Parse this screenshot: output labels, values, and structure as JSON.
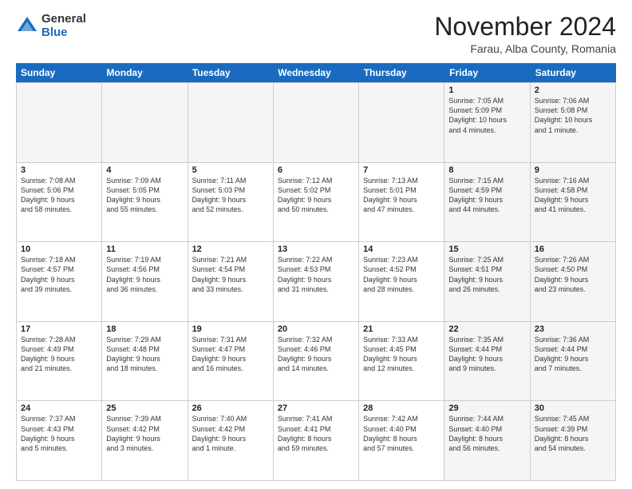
{
  "logo": {
    "general": "General",
    "blue": "Blue"
  },
  "title": {
    "month": "November 2024",
    "location": "Farau, Alba County, Romania"
  },
  "calendar": {
    "headers": [
      "Sunday",
      "Monday",
      "Tuesday",
      "Wednesday",
      "Thursday",
      "Friday",
      "Saturday"
    ],
    "rows": [
      [
        {
          "day": "",
          "info": "",
          "empty": true
        },
        {
          "day": "",
          "info": "",
          "empty": true
        },
        {
          "day": "",
          "info": "",
          "empty": true
        },
        {
          "day": "",
          "info": "",
          "empty": true
        },
        {
          "day": "",
          "info": "",
          "empty": true
        },
        {
          "day": "1",
          "info": "Sunrise: 7:05 AM\nSunset: 5:09 PM\nDaylight: 10 hours\nand 4 minutes.",
          "shaded": true
        },
        {
          "day": "2",
          "info": "Sunrise: 7:06 AM\nSunset: 5:08 PM\nDaylight: 10 hours\nand 1 minute.",
          "shaded": true
        }
      ],
      [
        {
          "day": "3",
          "info": "Sunrise: 7:08 AM\nSunset: 5:06 PM\nDaylight: 9 hours\nand 58 minutes."
        },
        {
          "day": "4",
          "info": "Sunrise: 7:09 AM\nSunset: 5:05 PM\nDaylight: 9 hours\nand 55 minutes."
        },
        {
          "day": "5",
          "info": "Sunrise: 7:11 AM\nSunset: 5:03 PM\nDaylight: 9 hours\nand 52 minutes."
        },
        {
          "day": "6",
          "info": "Sunrise: 7:12 AM\nSunset: 5:02 PM\nDaylight: 9 hours\nand 50 minutes."
        },
        {
          "day": "7",
          "info": "Sunrise: 7:13 AM\nSunset: 5:01 PM\nDaylight: 9 hours\nand 47 minutes."
        },
        {
          "day": "8",
          "info": "Sunrise: 7:15 AM\nSunset: 4:59 PM\nDaylight: 9 hours\nand 44 minutes.",
          "shaded": true
        },
        {
          "day": "9",
          "info": "Sunrise: 7:16 AM\nSunset: 4:58 PM\nDaylight: 9 hours\nand 41 minutes.",
          "shaded": true
        }
      ],
      [
        {
          "day": "10",
          "info": "Sunrise: 7:18 AM\nSunset: 4:57 PM\nDaylight: 9 hours\nand 39 minutes."
        },
        {
          "day": "11",
          "info": "Sunrise: 7:19 AM\nSunset: 4:56 PM\nDaylight: 9 hours\nand 36 minutes."
        },
        {
          "day": "12",
          "info": "Sunrise: 7:21 AM\nSunset: 4:54 PM\nDaylight: 9 hours\nand 33 minutes."
        },
        {
          "day": "13",
          "info": "Sunrise: 7:22 AM\nSunset: 4:53 PM\nDaylight: 9 hours\nand 31 minutes."
        },
        {
          "day": "14",
          "info": "Sunrise: 7:23 AM\nSunset: 4:52 PM\nDaylight: 9 hours\nand 28 minutes."
        },
        {
          "day": "15",
          "info": "Sunrise: 7:25 AM\nSunset: 4:51 PM\nDaylight: 9 hours\nand 26 minutes.",
          "shaded": true
        },
        {
          "day": "16",
          "info": "Sunrise: 7:26 AM\nSunset: 4:50 PM\nDaylight: 9 hours\nand 23 minutes.",
          "shaded": true
        }
      ],
      [
        {
          "day": "17",
          "info": "Sunrise: 7:28 AM\nSunset: 4:49 PM\nDaylight: 9 hours\nand 21 minutes."
        },
        {
          "day": "18",
          "info": "Sunrise: 7:29 AM\nSunset: 4:48 PM\nDaylight: 9 hours\nand 18 minutes."
        },
        {
          "day": "19",
          "info": "Sunrise: 7:31 AM\nSunset: 4:47 PM\nDaylight: 9 hours\nand 16 minutes."
        },
        {
          "day": "20",
          "info": "Sunrise: 7:32 AM\nSunset: 4:46 PM\nDaylight: 9 hours\nand 14 minutes."
        },
        {
          "day": "21",
          "info": "Sunrise: 7:33 AM\nSunset: 4:45 PM\nDaylight: 9 hours\nand 12 minutes."
        },
        {
          "day": "22",
          "info": "Sunrise: 7:35 AM\nSunset: 4:44 PM\nDaylight: 9 hours\nand 9 minutes.",
          "shaded": true
        },
        {
          "day": "23",
          "info": "Sunrise: 7:36 AM\nSunset: 4:44 PM\nDaylight: 9 hours\nand 7 minutes.",
          "shaded": true
        }
      ],
      [
        {
          "day": "24",
          "info": "Sunrise: 7:37 AM\nSunset: 4:43 PM\nDaylight: 9 hours\nand 5 minutes."
        },
        {
          "day": "25",
          "info": "Sunrise: 7:39 AM\nSunset: 4:42 PM\nDaylight: 9 hours\nand 3 minutes."
        },
        {
          "day": "26",
          "info": "Sunrise: 7:40 AM\nSunset: 4:42 PM\nDaylight: 9 hours\nand 1 minute."
        },
        {
          "day": "27",
          "info": "Sunrise: 7:41 AM\nSunset: 4:41 PM\nDaylight: 8 hours\nand 59 minutes."
        },
        {
          "day": "28",
          "info": "Sunrise: 7:42 AM\nSunset: 4:40 PM\nDaylight: 8 hours\nand 57 minutes."
        },
        {
          "day": "29",
          "info": "Sunrise: 7:44 AM\nSunset: 4:40 PM\nDaylight: 8 hours\nand 56 minutes.",
          "shaded": true
        },
        {
          "day": "30",
          "info": "Sunrise: 7:45 AM\nSunset: 4:39 PM\nDaylight: 8 hours\nand 54 minutes.",
          "shaded": true
        }
      ]
    ]
  }
}
